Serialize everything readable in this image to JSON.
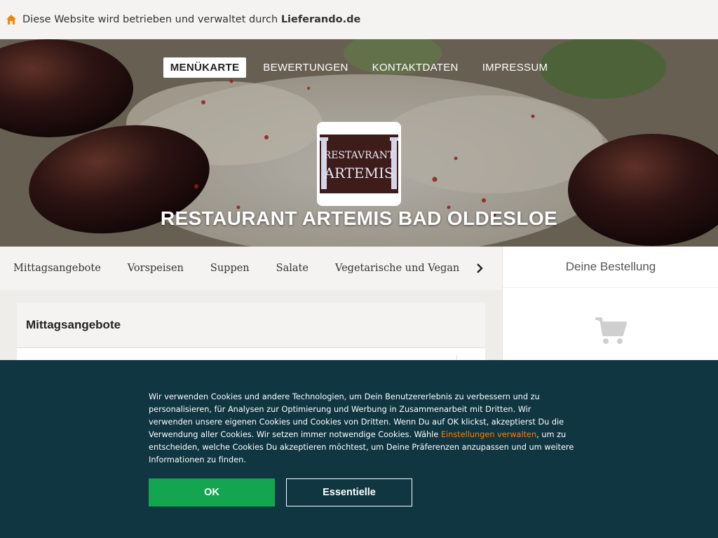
{
  "topbar": {
    "text_prefix": "Diese Website wird betrieben und verwaltet durch ",
    "brand": "Lieferando.de"
  },
  "nav": {
    "items": [
      "MENÜKARTE",
      "BEWERTUNGEN",
      "KONTAKTDATEN",
      "IMPRESSUM"
    ],
    "active": "MENÜKARTE"
  },
  "restaurant": {
    "title": "RESTAURANT ARTEMIS BAD OLDESLOE",
    "logo_line1": "RESTAVRANT",
    "logo_line2": "ARTEMIS"
  },
  "categories": [
    "Mittagsangebote",
    "Vorspeisen",
    "Suppen",
    "Salate",
    "Vegetarische und Vegane Speisen"
  ],
  "section": {
    "title": "Mittagsangebote"
  },
  "basket": {
    "title": "Deine Bestellung"
  },
  "cookie": {
    "message_before": "Wir verwenden Cookies und andere Technologien, um Dein Benutzererlebnis zu verbessern und zu personalisieren, für Analysen zur Optimierung und Werbung in Zusammenarbeit mit Dritten. Wir verwenden unsere eigenen Cookies und Cookies von Dritten. Wenn Du auf OK klickst, akzeptierst Du die Verwendung aller Cookies. Wir setzen immer notwendige Cookies. Wähle ",
    "link": "Einstellungen verwalten",
    "message_after": ", um zu entscheiden, welche Cookies Du akzeptieren möchtest, um Deine Präferenzen anzupassen und um weitere Informationen zu finden.",
    "ok_label": "OK",
    "essential_label": "Essentielle"
  },
  "colors": {
    "accent": "#ff8000",
    "banner_bg": "#0f3641",
    "ok_green": "#13a550"
  },
  "icons": [
    "home-icon",
    "chevron-right-icon",
    "shopping-cart-icon"
  ]
}
